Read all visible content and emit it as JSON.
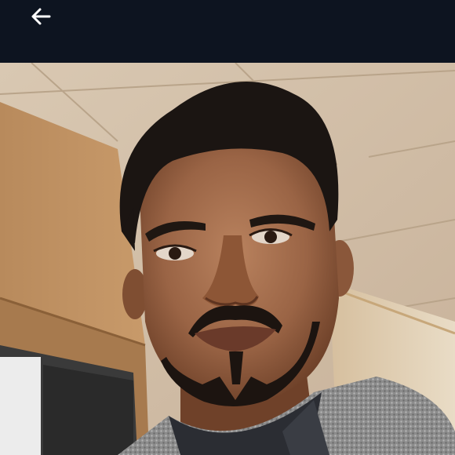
{
  "app": {
    "background_color": "#0d1420"
  },
  "header": {
    "back_icon": "arrow-left-icon",
    "back_icon_color": "#ffffff"
  },
  "photo": {
    "subject": "profile-photo"
  }
}
